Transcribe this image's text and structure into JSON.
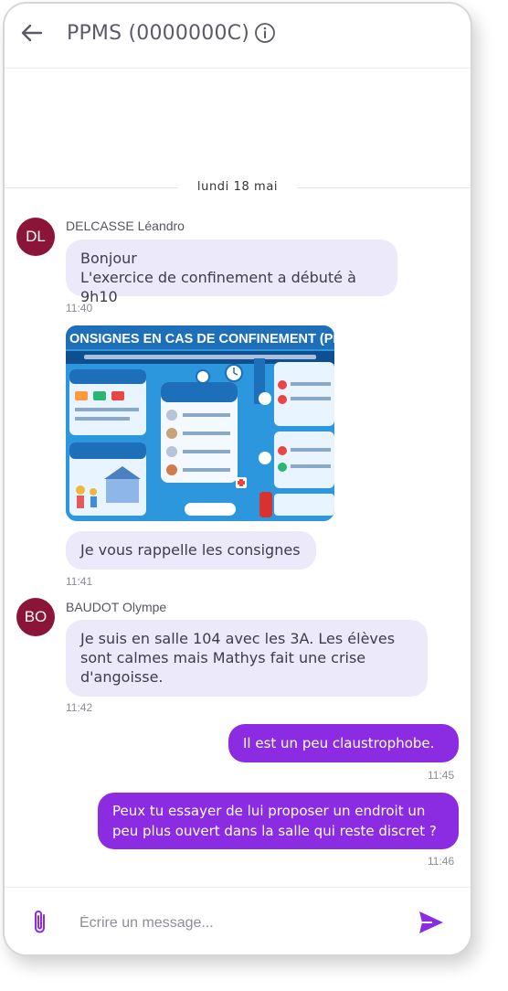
{
  "header": {
    "title": "PPMS (0000000C)"
  },
  "date_separator": "lundi 18 mai",
  "messages": [
    {
      "sender_initials": "DL",
      "sender_name": "DELCASSE Léandro",
      "lines": [
        "Bonjour",
        "L'exercice de confinement a débuté à 9h10"
      ],
      "time": "11:40"
    },
    {
      "image_title": "ONSIGNES EN CAS DE CONFINEMENT (PPM",
      "text": "Je vous rappelle les consignes",
      "time": "11:41"
    },
    {
      "sender_initials": "BO",
      "sender_name": "BAUDOT Olympe",
      "lines": [
        "Je suis en salle 104 avec les 3A. Les élèves",
        "sont calmes mais Mathys fait une crise",
        "d'angoisse."
      ],
      "time": "11:42"
    },
    {
      "text": "Il est un peu claustrophobe.",
      "time": "11:45"
    },
    {
      "lines": [
        "Peux tu essayer de lui proposer un endroit un",
        "peu plus ouvert dans la salle qui reste discret ?"
      ],
      "time": "11:46"
    }
  ],
  "composer": {
    "placeholder": "Écrire un message..."
  },
  "colors": {
    "avatar": "#8a1538",
    "incoming_bubble": "#ece9fb",
    "outgoing_bubble": "#8b2be2",
    "accent": "#8b2be2"
  },
  "icons": {
    "back": "arrow-left-icon",
    "info": "info-icon",
    "attach": "paperclip-icon",
    "send": "send-icon"
  }
}
